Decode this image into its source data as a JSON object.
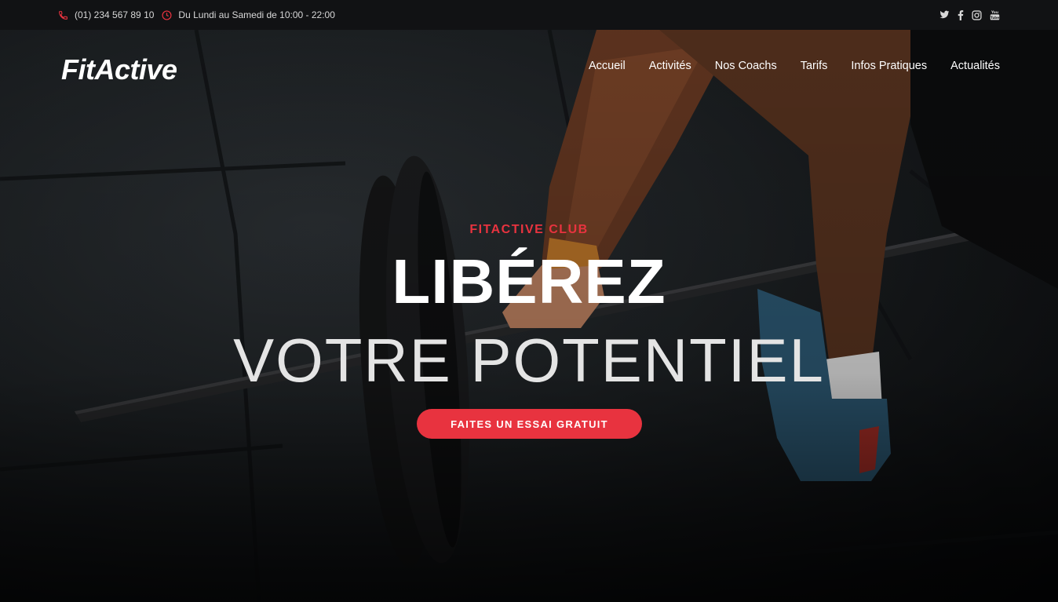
{
  "topbar": {
    "phone": "(01) 234 567 89 10",
    "hours": "Du Lundi au Samedi de 10:00 - 22:00",
    "accent": "#e8333f",
    "social_icons": [
      "twitter-icon",
      "facebook-icon",
      "instagram-icon",
      "youtube-icon"
    ]
  },
  "header": {
    "logo": "FitActive",
    "nav": [
      "Accueil",
      "Activités",
      "Nos Coachs",
      "Tarifs",
      "Infos Pratiques",
      "Actualités"
    ]
  },
  "hero": {
    "kicker": "FITACTIVE CLUB",
    "headline": "LIBÉREZ",
    "subline": "VOTRE POTENTIEL",
    "cta": "FAITES UN ESSAI GRATUIT"
  }
}
